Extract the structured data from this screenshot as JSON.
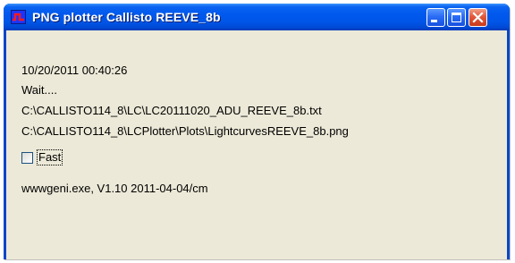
{
  "window": {
    "title": "PNG plotter Callisto REEVE_8b",
    "icon": "plotter-app-icon",
    "controls": [
      "minimize-icon",
      "maximize-icon",
      "close-icon"
    ],
    "colors": {
      "titlebar": "#0058ee",
      "client_bg": "#ece9d8",
      "close_button": "#e3593a",
      "app_icon_bg": "#1a34ff",
      "app_icon_mark": "#ff1a1a"
    }
  },
  "content": {
    "timestamp": "10/20/2011 00:40:26",
    "status": "Wait....",
    "input_file": "C:\\CALLISTO114_8\\LC\\LC20111020_ADU_REEVE_8b.txt",
    "output_file": "C:\\CALLISTO114_8\\LCPlotter\\Plots\\LightcurvesREEVE_8b.png",
    "fast_checkbox": {
      "label": "Fast",
      "checked": false
    },
    "version": "wwwgeni.exe, V1.10 2011-04-04/cm"
  }
}
